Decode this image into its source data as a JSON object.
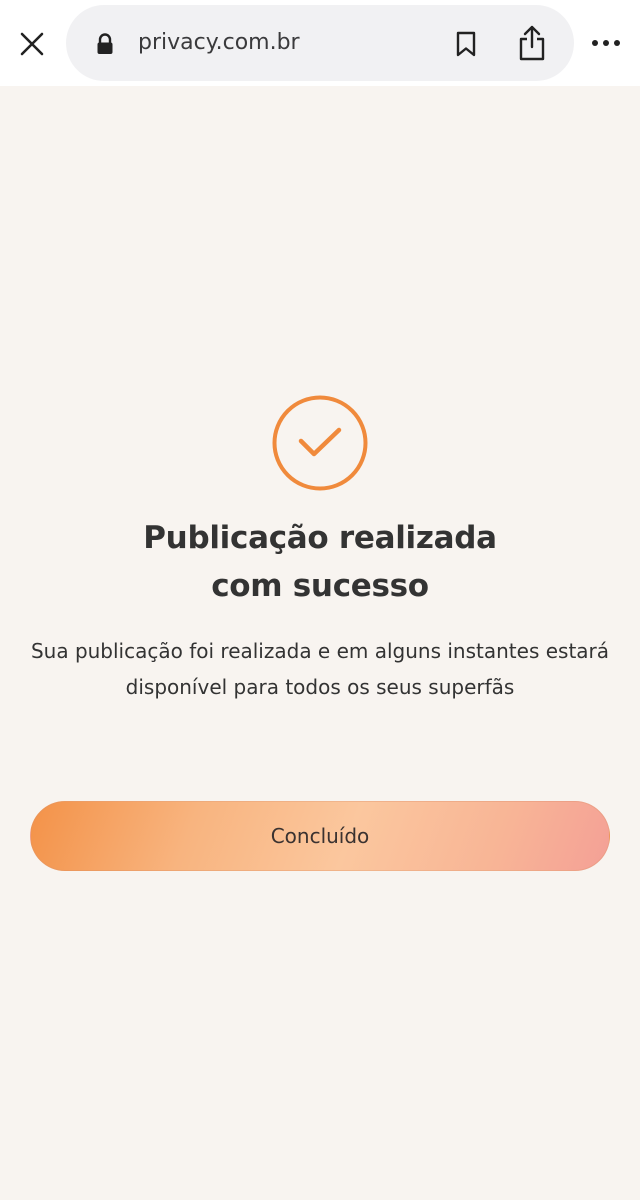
{
  "browser": {
    "url": "privacy.com.br",
    "icons": {
      "close": "close-icon",
      "lock": "lock-icon",
      "bookmark": "bookmark-icon",
      "share": "share-icon",
      "more": "more-icon"
    }
  },
  "confirmation": {
    "icon": "check-circle-icon",
    "accent_color": "#f08a3c",
    "title_line1": "Publicação realizada",
    "title_line2": "com sucesso",
    "message": "Sua publicação foi realizada e em alguns instantes estará disponível para todos os seus superfãs",
    "done_label": "Concluído"
  }
}
